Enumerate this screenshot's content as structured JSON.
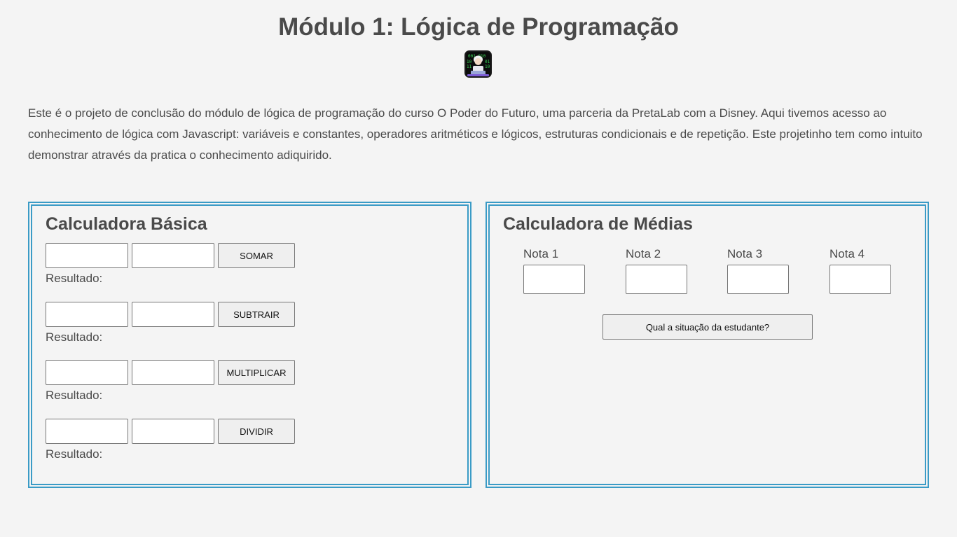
{
  "header": {
    "title": "Módulo 1: Lógica de Programação",
    "logo_icon": "woman-coder-icon"
  },
  "intro": {
    "text": "Este é o projeto de conclusão do módulo de lógica de programação do curso O Poder do Futuro, uma parceria da PretaLab com a Disney. Aqui tivemos acesso ao conhecimento de lógica com Javascript: variáveis e constantes, operadores aritméticos e lógicos, estruturas condicionais e de repetição. Este projetinho tem como intuito demonstrar através da pratica o conhecimento adiquirido."
  },
  "basic_calculator": {
    "title": "Calculadora Básica",
    "border_color": "#3a9bc6",
    "operations": [
      {
        "button_label": "SOMAR",
        "result_label": "Resultado:",
        "value_a": "",
        "value_b": ""
      },
      {
        "button_label": "SUBTRAIR",
        "result_label": "Resultado:",
        "value_a": "",
        "value_b": ""
      },
      {
        "button_label": "MULTIPLICAR",
        "result_label": "Resultado:",
        "value_a": "",
        "value_b": ""
      },
      {
        "button_label": "DIVIDIR",
        "result_label": "Resultado:",
        "value_a": "",
        "value_b": ""
      }
    ]
  },
  "average_calculator": {
    "title": "Calculadora de Médias",
    "grades": [
      {
        "label": "Nota 1",
        "value": ""
      },
      {
        "label": "Nota 2",
        "value": ""
      },
      {
        "label": "Nota 3",
        "value": ""
      },
      {
        "label": "Nota 4",
        "value": ""
      }
    ],
    "status_button_label": "Qual a situação da estudante?"
  }
}
